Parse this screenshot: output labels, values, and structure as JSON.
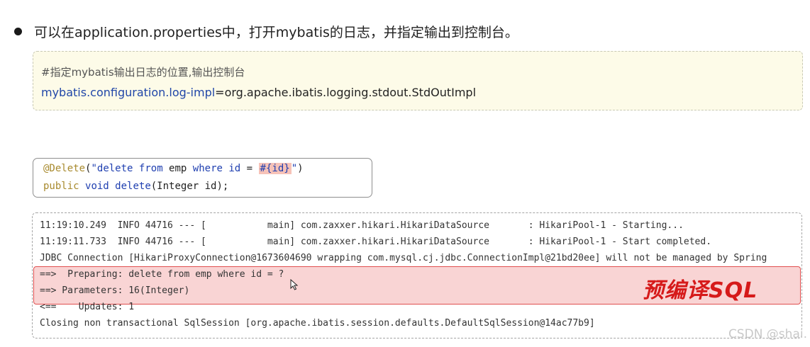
{
  "bullet": {
    "text": "可以在application.properties中，打开mybatis的日志，并指定输出到控制台。"
  },
  "config": {
    "comment": "#指定mybatis输出日志的位置,输出控制台",
    "key": "mybatis.configuration.log-impl",
    "eq": "=",
    "value": "org.apache.ibatis.logging.stdout.StdOutImpl"
  },
  "code": {
    "line1": {
      "annotation": "@Delete",
      "open": "(",
      "quote_open": "\"",
      "kw_delete": "delete",
      "sp1": " ",
      "kw_from": "from",
      "emp": " emp ",
      "kw_where": "where",
      "rest1": " ",
      "kw_id": "id",
      "eq": " = ",
      "placeholder": "#{id}",
      "quote_close": "\"",
      "close": ")"
    },
    "line2": {
      "kw_public": "public",
      "sp1": " ",
      "kw_void": "void",
      "sp2": " ",
      "method": "delete",
      "args": "(Integer id);"
    }
  },
  "log": {
    "lines": [
      "11:19:10.249  INFO 44716 --- [           main] com.zaxxer.hikari.HikariDataSource       : HikariPool-1 - Starting...",
      "11:19:11.733  INFO 44716 --- [           main] com.zaxxer.hikari.HikariDataSource       : HikariPool-1 - Start completed.",
      "JDBC Connection [HikariProxyConnection@1673604690 wrapping com.mysql.cj.jdbc.ConnectionImpl@21bd20ee] will not be managed by Spring",
      "==>  Preparing: delete from emp where id = ?",
      "==> Parameters: 16(Integer)",
      "<==    Updates: 1",
      "Closing non transactional SqlSession [org.apache.ibatis.session.defaults.DefaultSqlSession@14ac77b9]"
    ],
    "stamp": "预编译SQL"
  },
  "watermark": "CSDN @shai."
}
